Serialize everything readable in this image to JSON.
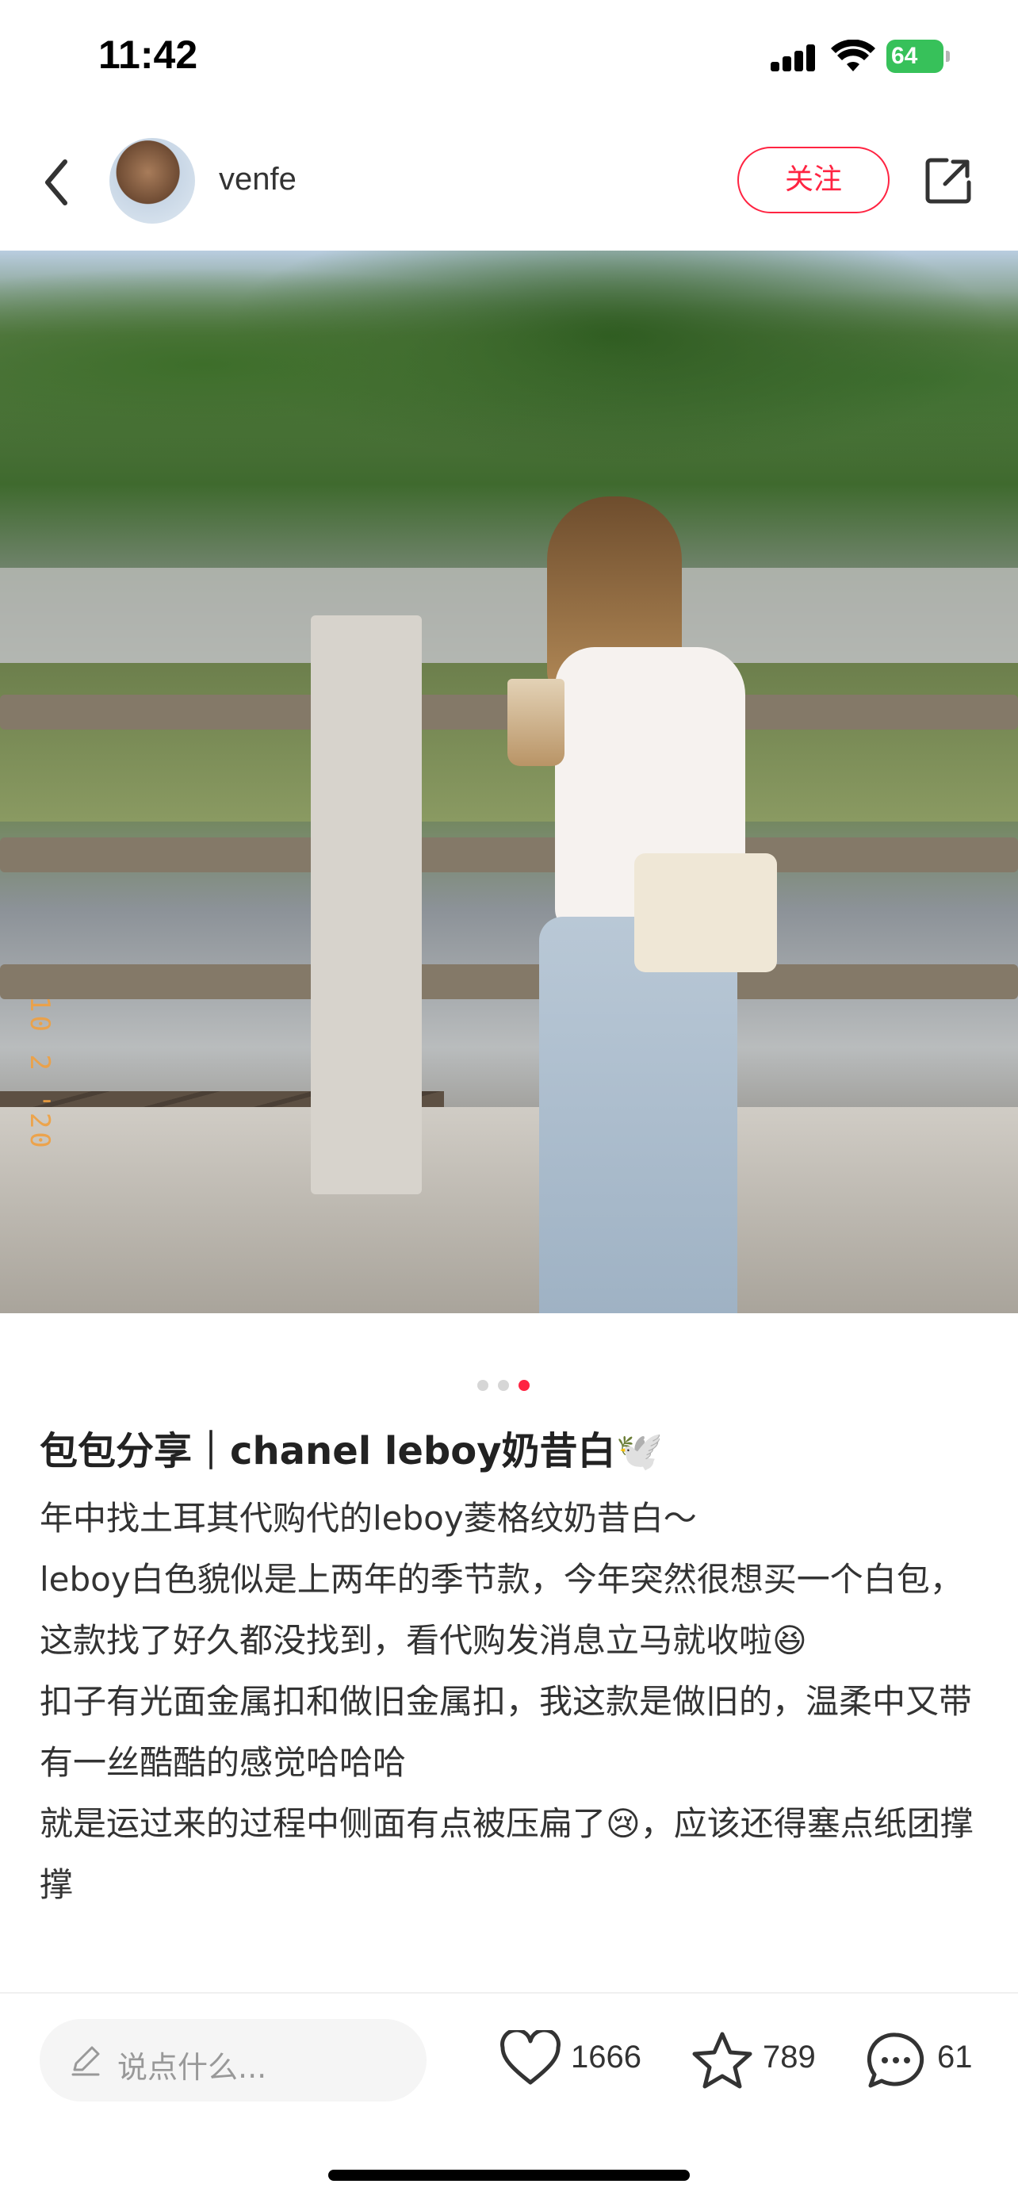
{
  "status_bar": {
    "time": "11:42",
    "battery": "64",
    "icons": [
      "cellular-signal-icon",
      "wifi-icon",
      "battery-charging-icon"
    ]
  },
  "header": {
    "username": "venfe",
    "follow_label": "关注",
    "icons": [
      "back-arrow-icon",
      "share-icon"
    ]
  },
  "photo": {
    "date_stamp": "10 2 '20",
    "pager": {
      "count": 3,
      "active_index": 2
    }
  },
  "post": {
    "title": "包包分享｜chanel leboy奶昔白🕊️",
    "body": [
      "年中找土耳其代购代的leboy菱格纹奶昔白～",
      "leboy白色貌似是上两年的季节款，今年突然很想买一个白包，这款找了好久都没找到，看代购发消息立马就收啦😆",
      "扣子有光面金属扣和做旧金属扣，我这款是做旧的，温柔中又带有一丝酷酷的感觉哈哈哈",
      "就是运过来的过程中侧面有点被压扁了😢，应该还得塞点纸团撑撑"
    ]
  },
  "bottom_bar": {
    "comment_placeholder": "说点什么...",
    "likes": "1666",
    "collects": "789",
    "comments": "61"
  },
  "colors": {
    "accent": "#ff2442",
    "battery_green": "#37c15a",
    "pager_active": "#ff2442",
    "pager_inactive": "#d6d6d6"
  }
}
